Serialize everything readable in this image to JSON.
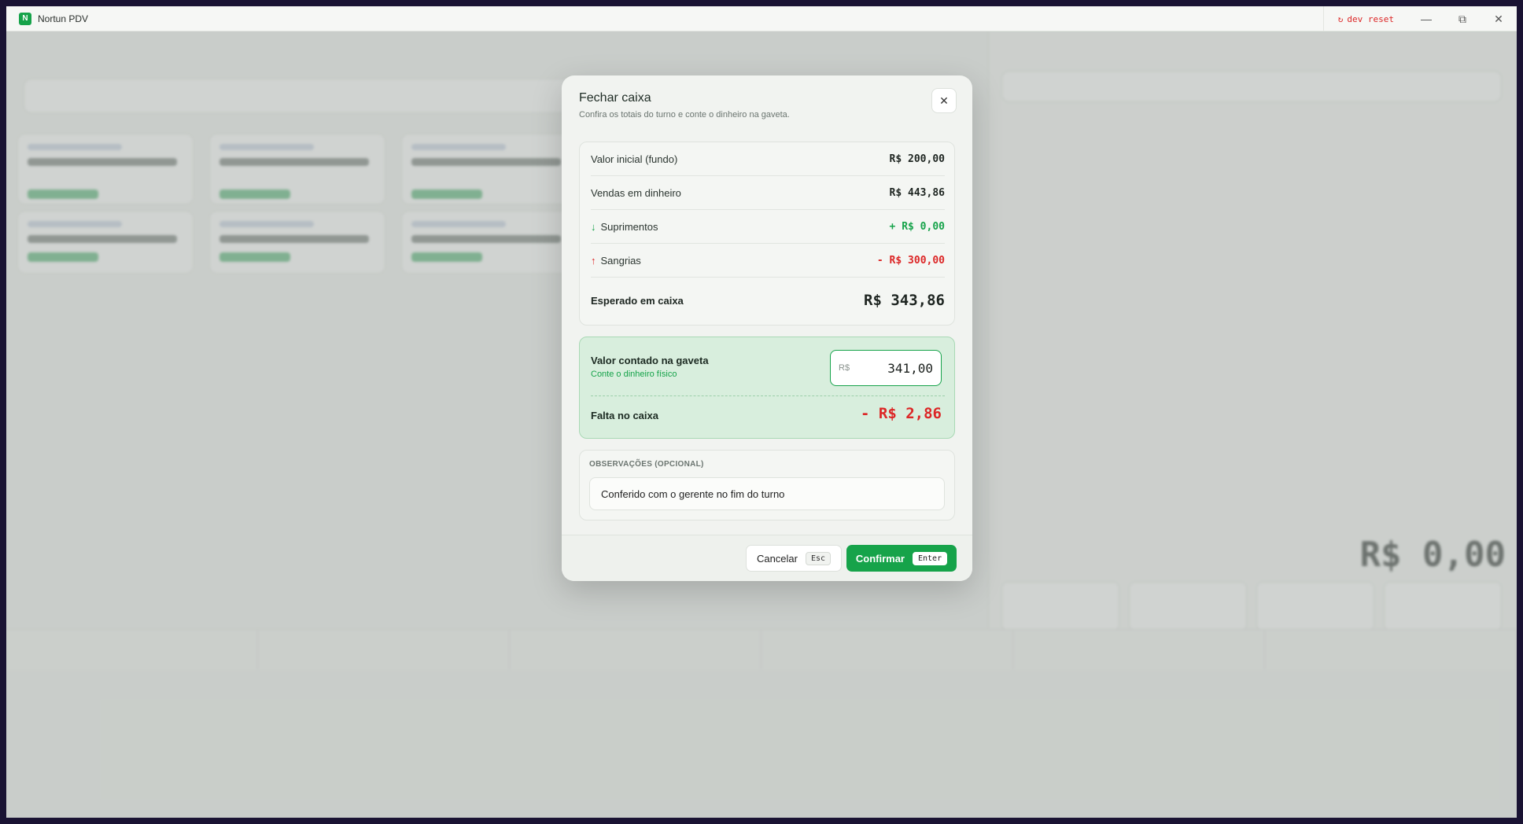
{
  "window": {
    "app_title": "Nortun PDV",
    "app_logo_letter": "N",
    "dev_reset_label": "dev reset",
    "minimize_glyph": "—",
    "restore_glyph": "⧉",
    "close_glyph": "✕"
  },
  "modal": {
    "title": "Fechar caixa",
    "subtitle": "Confira os totais do turno e conte o dinheiro na gaveta.",
    "close_glyph": "✕",
    "summary": {
      "initial_label": "Valor inicial (fundo)",
      "initial_value": "R$ 200,00",
      "cash_sales_label": "Vendas em dinheiro",
      "cash_sales_value": "R$ 443,86",
      "supplies_label": "Suprimentos",
      "supplies_value": "+ R$ 0,00",
      "withdrawals_label": "Sangrias",
      "withdrawals_value": "- R$ 300,00",
      "expected_label": "Esperado em caixa",
      "expected_value": "R$ 343,86"
    },
    "counted": {
      "title": "Valor contado na gaveta",
      "hint": "Conte o dinheiro físico",
      "currency": "R$",
      "value": "341,00",
      "shortage_label": "Falta no caixa",
      "shortage_value": "- R$ 2,86"
    },
    "notes": {
      "label": "OBSERVAÇÕES (OPCIONAL)",
      "value": "Conferido com o gerente no fim do turno"
    },
    "footer": {
      "cancel_label": "Cancelar",
      "cancel_key": "Esc",
      "confirm_label": "Confirmar",
      "confirm_key": "Enter"
    }
  },
  "background": {
    "total_value": "R$ 0,00"
  },
  "colors": {
    "accent": "#16a34a",
    "danger": "#dc2626",
    "counted_bg": "#d8eedd"
  }
}
